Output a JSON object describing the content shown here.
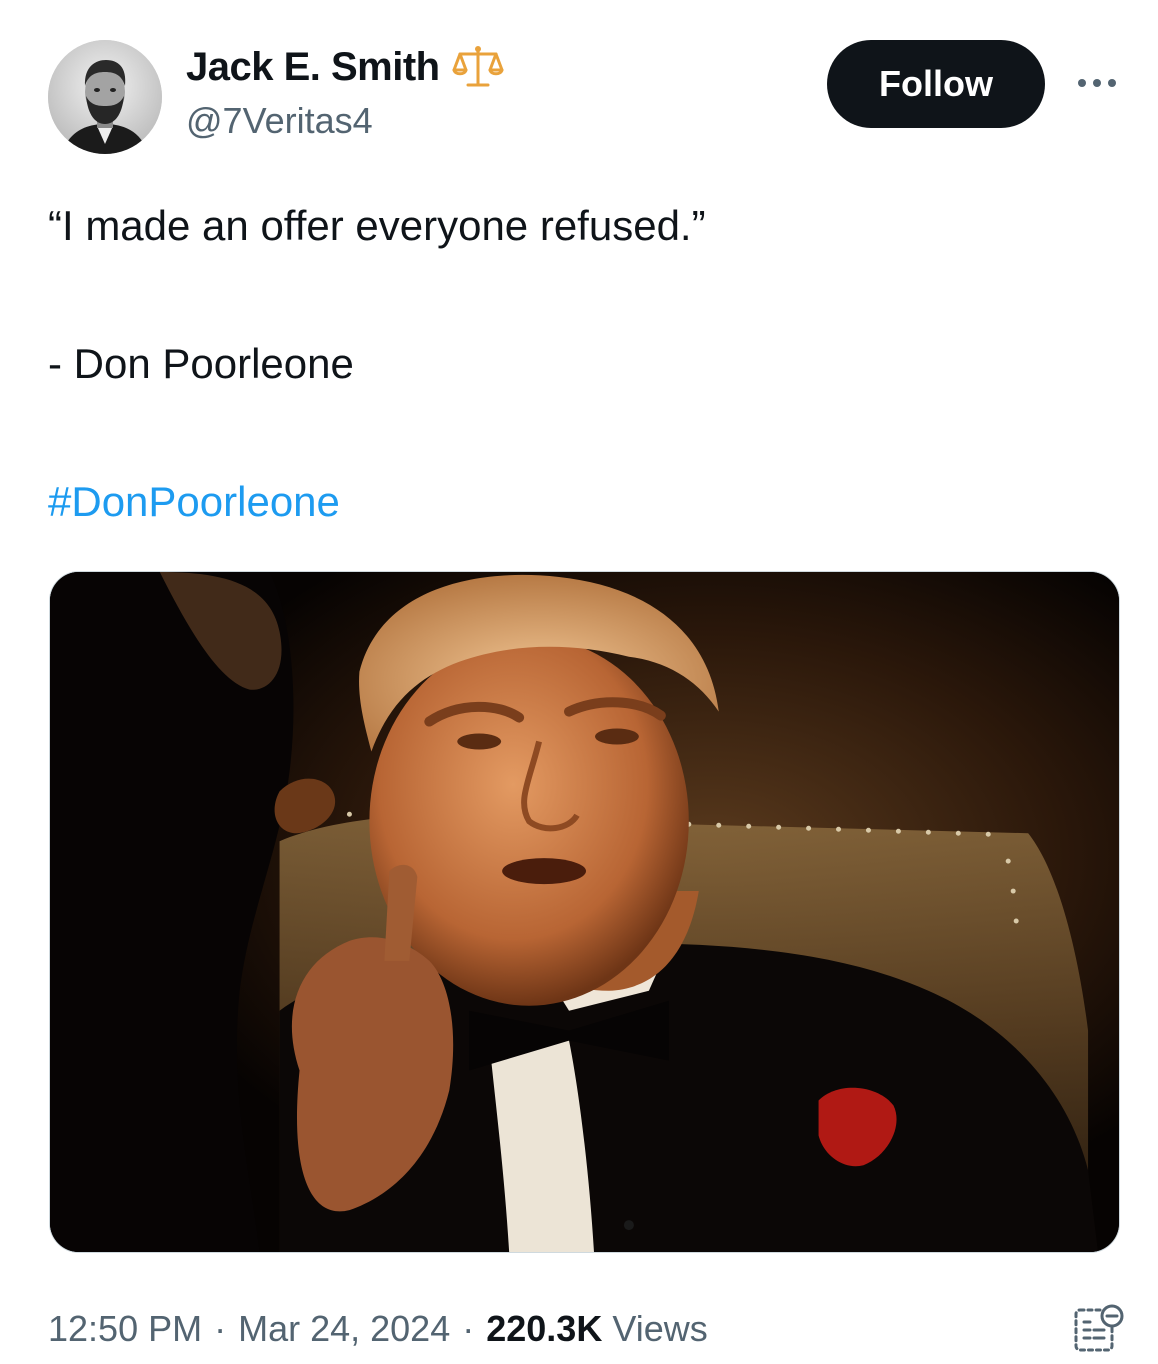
{
  "author": {
    "display_name": "Jack E. Smith",
    "handle": "@7Veritas4",
    "badge_icon": "balance-scale-icon",
    "avatar": "profile-photo"
  },
  "actions": {
    "follow_label": "Follow",
    "more_icon": "more-horizontal-icon"
  },
  "tweet": {
    "lines": [
      "“I made an offer everyone refused.”",
      "- Don Poorleone"
    ],
    "hashtag": "#DonPoorleone",
    "media": {
      "type": "photo"
    }
  },
  "meta": {
    "time": "12:50 PM",
    "separator": "·",
    "date": "Mar 24, 2024",
    "views_count": "220.3K",
    "views_label": "Views",
    "analytics_icon": "view-analytics-icon"
  },
  "colors": {
    "text_primary": "#0f1419",
    "text_secondary": "#536471",
    "link": "#1d9bf0",
    "follow_bg": "#0f1419",
    "badge": "#e9a23b"
  }
}
